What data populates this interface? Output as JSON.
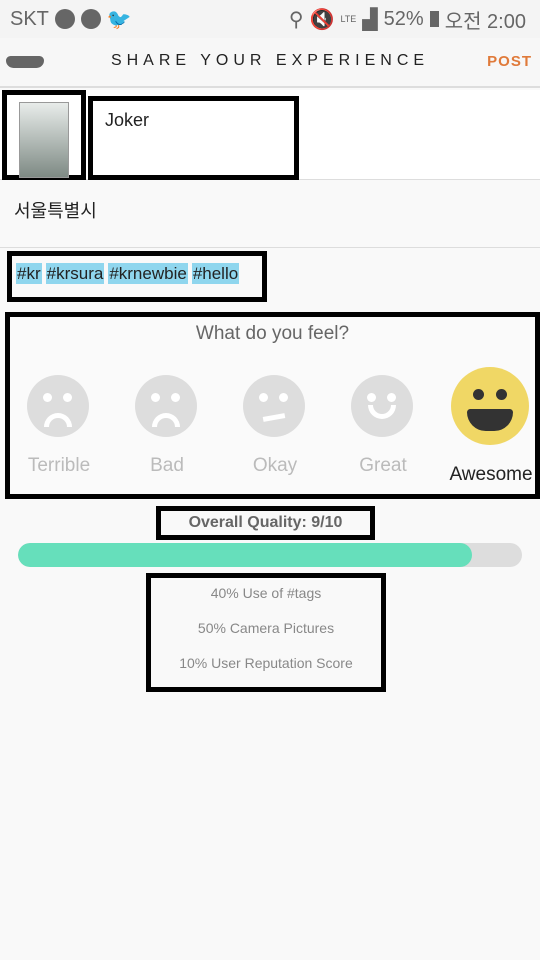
{
  "status_bar": {
    "carrier": "SKT",
    "battery": "52%",
    "time": "오전 2:00",
    "network": "LTE",
    "icons": [
      "telegram-icon",
      "globe-icon",
      "twitter-icon",
      "location-icon",
      "mute-icon",
      "lte-icon",
      "signal-icon",
      "battery-icon"
    ]
  },
  "header": {
    "title": "SHARE YOUR EXPERIENCE",
    "post_label": "POST",
    "logo_icon": "mask-icon"
  },
  "post": {
    "name": "Joker",
    "location": "서울특별시",
    "tags": [
      "#kr",
      "#krsura",
      "#krnewbie",
      "#hello"
    ]
  },
  "feel": {
    "question": "What do you feel?",
    "options": [
      "Terrible",
      "Bad",
      "Okay",
      "Great",
      "Awesome"
    ],
    "selected": "Awesome",
    "selected_color": "#f0d765"
  },
  "quality": {
    "label": "Overall Quality: 9/10",
    "progress_percent": 90,
    "bar_color": "#66dfbb"
  },
  "breakdown": [
    "40% Use of #tags",
    "50% Camera Pictures",
    "10% User Reputation Score"
  ]
}
